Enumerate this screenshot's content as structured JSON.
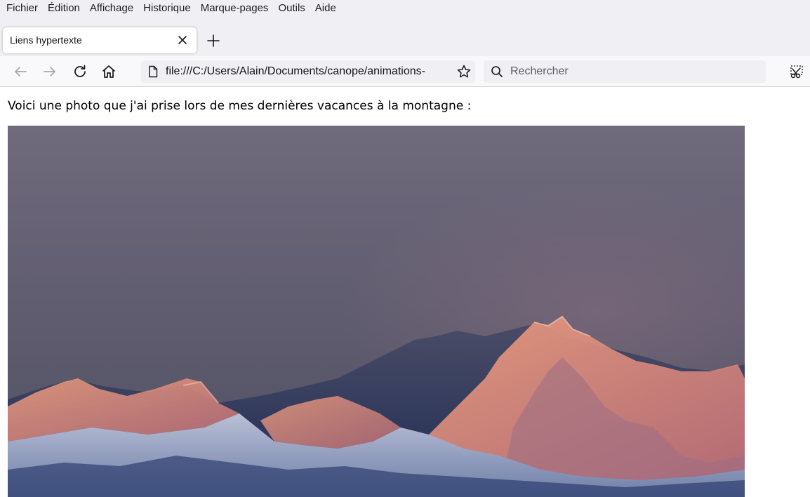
{
  "menu": {
    "items": [
      {
        "label": "Fichier"
      },
      {
        "label": "Édition"
      },
      {
        "label": "Affichage"
      },
      {
        "label": "Historique"
      },
      {
        "label": "Marque-pages"
      },
      {
        "label": "Outils"
      },
      {
        "label": "Aide"
      }
    ]
  },
  "tabs": [
    {
      "title": "Liens hypertexte",
      "active": true
    }
  ],
  "toolbar": {
    "url": "file:///C:/Users/Alain/Documents/canope/animations-",
    "search_placeholder": "Rechercher"
  },
  "page": {
    "intro_text": "Voici une photo que j'ai prise lors de mes dernières vacances à la montagne :"
  },
  "icons": {
    "back": "arrow-left-icon",
    "forward": "arrow-right-icon",
    "reload": "reload-icon",
    "home": "home-icon",
    "page": "page-icon",
    "bookmark": "star-icon",
    "search": "search-icon",
    "screenshot": "screenshot-icon",
    "close": "close-icon",
    "new_tab": "plus-icon"
  },
  "colors": {
    "chrome_bg": "#f0f0f4",
    "toolbar_bg": "#f9f9fb",
    "text": "#15141a",
    "sky_top": "#6f6a7c",
    "sky_bottom": "#4f4f63"
  }
}
